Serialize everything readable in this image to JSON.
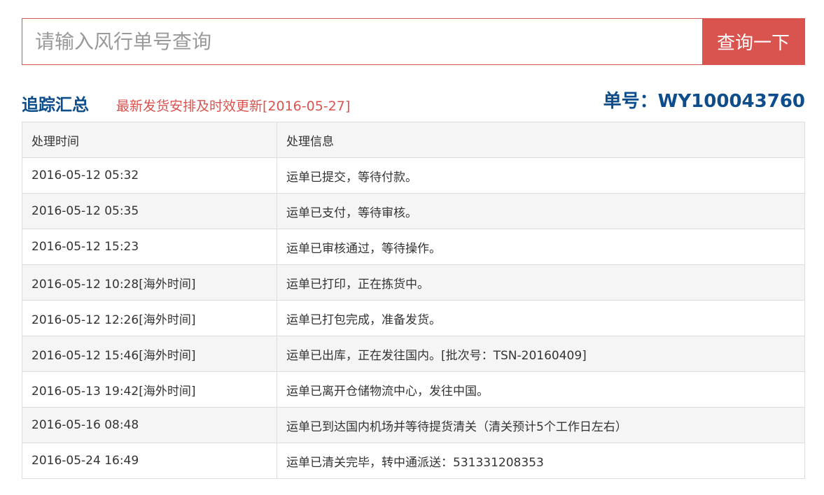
{
  "search": {
    "placeholder": "请输入风行单号查询",
    "button_label": "查询一下"
  },
  "summary": {
    "title": "追踪汇总",
    "update_note": "最新发货安排及时效更新[2016-05-27]",
    "waybill_label": "单号：WY100043760"
  },
  "colors": {
    "accent_red": "#d9534f",
    "title_blue": "#0d4d8c",
    "row_alt": "#f5f5f5",
    "border": "#dddddd"
  },
  "table": {
    "headers": [
      "处理时间",
      "处理信息"
    ],
    "rows": [
      {
        "time": "2016-05-12 05:32",
        "info": "运单已提交，等待付款。"
      },
      {
        "time": "2016-05-12 05:35",
        "info": "运单已支付，等待审核。"
      },
      {
        "time": "2016-05-12 15:23",
        "info": "运单已审核通过，等待操作。"
      },
      {
        "time": "2016-05-12 10:28[海外时间]",
        "info": "运单已打印，正在拣货中。"
      },
      {
        "time": "2016-05-12 12:26[海外时间]",
        "info": "运单已打包完成，准备发货。"
      },
      {
        "time": "2016-05-12 15:46[海外时间]",
        "info": "运单已出库，正在发往国内。[批次号：TSN-20160409]"
      },
      {
        "time": "2016-05-13 19:42[海外时间]",
        "info": "运单已离开仓储物流中心，发往中国。"
      },
      {
        "time": "2016-05-16 08:48",
        "info": "运单已到达国内机场并等待提货清关（清关预计5个工作日左右）"
      },
      {
        "time": "2016-05-24 16:49",
        "info": "运单已清关完毕，转中通派送：531331208353"
      }
    ]
  }
}
